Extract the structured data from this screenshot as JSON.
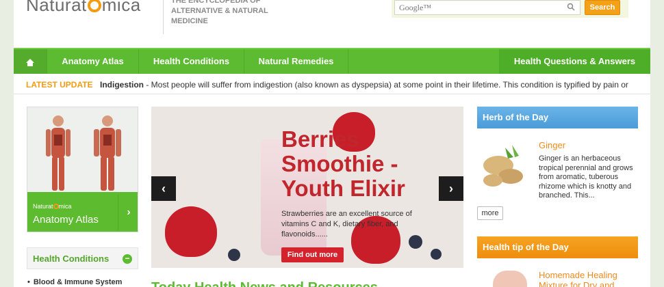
{
  "brand": {
    "logo_left": "Naturat",
    "logo_right": "mica",
    "tagline": "THE ENCYCLOPEDIA OF ALTERNATIVE & NATURAL MEDICINE"
  },
  "search": {
    "placeholder": "Google™",
    "button": "Search"
  },
  "nav": {
    "items": [
      "Anatomy Atlas",
      "Health Conditions",
      "Natural Remedies",
      "Health Questions & Answers"
    ]
  },
  "ticker": {
    "label": "LATEST UPDATE",
    "topic": "Indigestion",
    "text": " - Most people will suffer from indigestion (also known as dyspepsia) at some point in their lifetime. This condition is typified by pain or"
  },
  "atlas": {
    "mini_logo_left": "Naturat",
    "mini_logo_right": "mica",
    "title": "Anatomy Atlas",
    "arrow": "›"
  },
  "health_conditions": {
    "title": "Health Conditions",
    "toggle": "−",
    "items": [
      "Blood & Immune System"
    ]
  },
  "slider": {
    "title": "Berries Smoothie - Youth Elixir",
    "text": "Strawberries are an excellent source of vitamins C and K, dietary fiber, and flavonoids......",
    "button": "Find out more",
    "prev": "‹",
    "next": "›"
  },
  "main_heading": "Today Health News and Resources",
  "herb": {
    "header": "Herb of the Day",
    "name": "Ginger",
    "description": "Ginger is an herbaceous tropical perennial and grows from aromatic, tuberous rhizome which is knotty and branched. This...",
    "more": "more"
  },
  "tip": {
    "header": "Health tip of the Day",
    "title": "Homemade Healing Mixture for Dry and"
  },
  "colors": {
    "nav_green": "#5dbb32",
    "accent_orange": "#f39c12",
    "herb_blue": "#4b9bd8",
    "slide_red": "#c0262c"
  }
}
